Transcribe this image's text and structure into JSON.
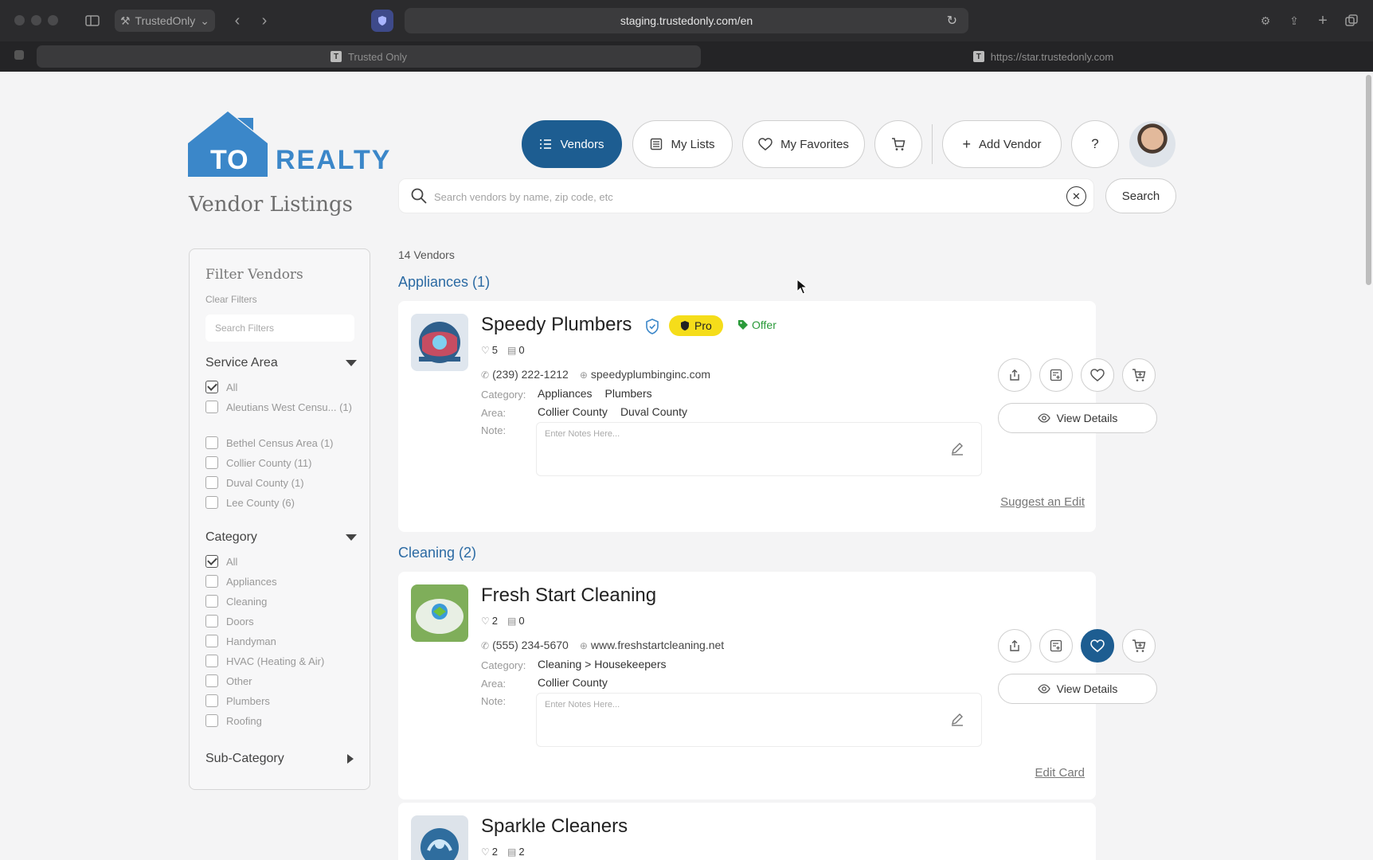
{
  "browser": {
    "profile": "TrustedOnly",
    "url": "staging.trustedonly.com/en",
    "tabs": [
      {
        "title": "Trusted Only"
      },
      {
        "title": "https://star.trustedonly.com"
      }
    ]
  },
  "logo": {
    "text_to": "TO",
    "text_realty": "REALTY"
  },
  "nav": {
    "vendors": "Vendors",
    "my_lists": "My Lists",
    "my_favorites": "My Favorites",
    "add_vendor": "Add Vendor",
    "help": "?"
  },
  "page_title": "Vendor Listings",
  "search": {
    "placeholder": "Search vendors by name, zip code, etc",
    "button": "Search"
  },
  "vendor_count": "14 Vendors",
  "filters": {
    "title": "Filter Vendors",
    "clear": "Clear Filters",
    "search_placeholder": "Search Filters",
    "service_area": {
      "label": "Service Area",
      "options": [
        {
          "label": "All",
          "checked": true
        },
        {
          "label": "Aleutians West Censu... (1)",
          "checked": false
        },
        {
          "label": "Bethel Census Area (1)",
          "checked": false
        },
        {
          "label": "Collier County (11)",
          "checked": false
        },
        {
          "label": "Duval County (1)",
          "checked": false
        },
        {
          "label": "Lee County (6)",
          "checked": false
        }
      ]
    },
    "category": {
      "label": "Category",
      "options": [
        {
          "label": "All",
          "checked": true
        },
        {
          "label": "Appliances",
          "checked": false
        },
        {
          "label": "Cleaning",
          "checked": false
        },
        {
          "label": "Doors",
          "checked": false
        },
        {
          "label": "Handyman",
          "checked": false
        },
        {
          "label": "HVAC (Heating & Air)",
          "checked": false
        },
        {
          "label": "Other",
          "checked": false
        },
        {
          "label": "Plumbers",
          "checked": false
        },
        {
          "label": "Roofing",
          "checked": false
        }
      ]
    },
    "sub_category": {
      "label": "Sub-Category"
    }
  },
  "groups": [
    {
      "heading": "Appliances (1)"
    },
    {
      "heading": "Cleaning (2)"
    }
  ],
  "vendors": [
    {
      "name": "Speedy Plumbers",
      "pro_label": "Pro",
      "offer_label": "Offer",
      "likes": "5",
      "lists": "0",
      "phone": "(239) 222-1212",
      "website": "speedyplumbinginc.com",
      "category_label": "Category:",
      "categories": [
        "Appliances",
        "Plumbers"
      ],
      "area_label": "Area:",
      "areas": [
        "Collier County",
        "Duval County"
      ],
      "note_label": "Note:",
      "note_placeholder": "Enter Notes Here...",
      "view_details": "View Details",
      "footer_link": "Suggest an Edit",
      "favorited": false
    },
    {
      "name": "Fresh Start Cleaning",
      "likes": "2",
      "lists": "0",
      "phone": "(555) 234-5670",
      "website": "www.freshstartcleaning.net",
      "category_label": "Category:",
      "categories": [
        "Cleaning > Housekeepers"
      ],
      "area_label": "Area:",
      "areas": [
        "Collier County"
      ],
      "note_label": "Note:",
      "note_placeholder": "Enter Notes Here...",
      "view_details": "View Details",
      "footer_link": "Edit Card",
      "favorited": true
    },
    {
      "name": "Sparkle Cleaners",
      "likes": "2",
      "lists": "2"
    }
  ],
  "colors": {
    "brand_blue": "#1d5d91",
    "heading_blue": "#2b6aa3",
    "pro_yellow": "#f5dd1a",
    "offer_green": "#2a9a3a"
  }
}
